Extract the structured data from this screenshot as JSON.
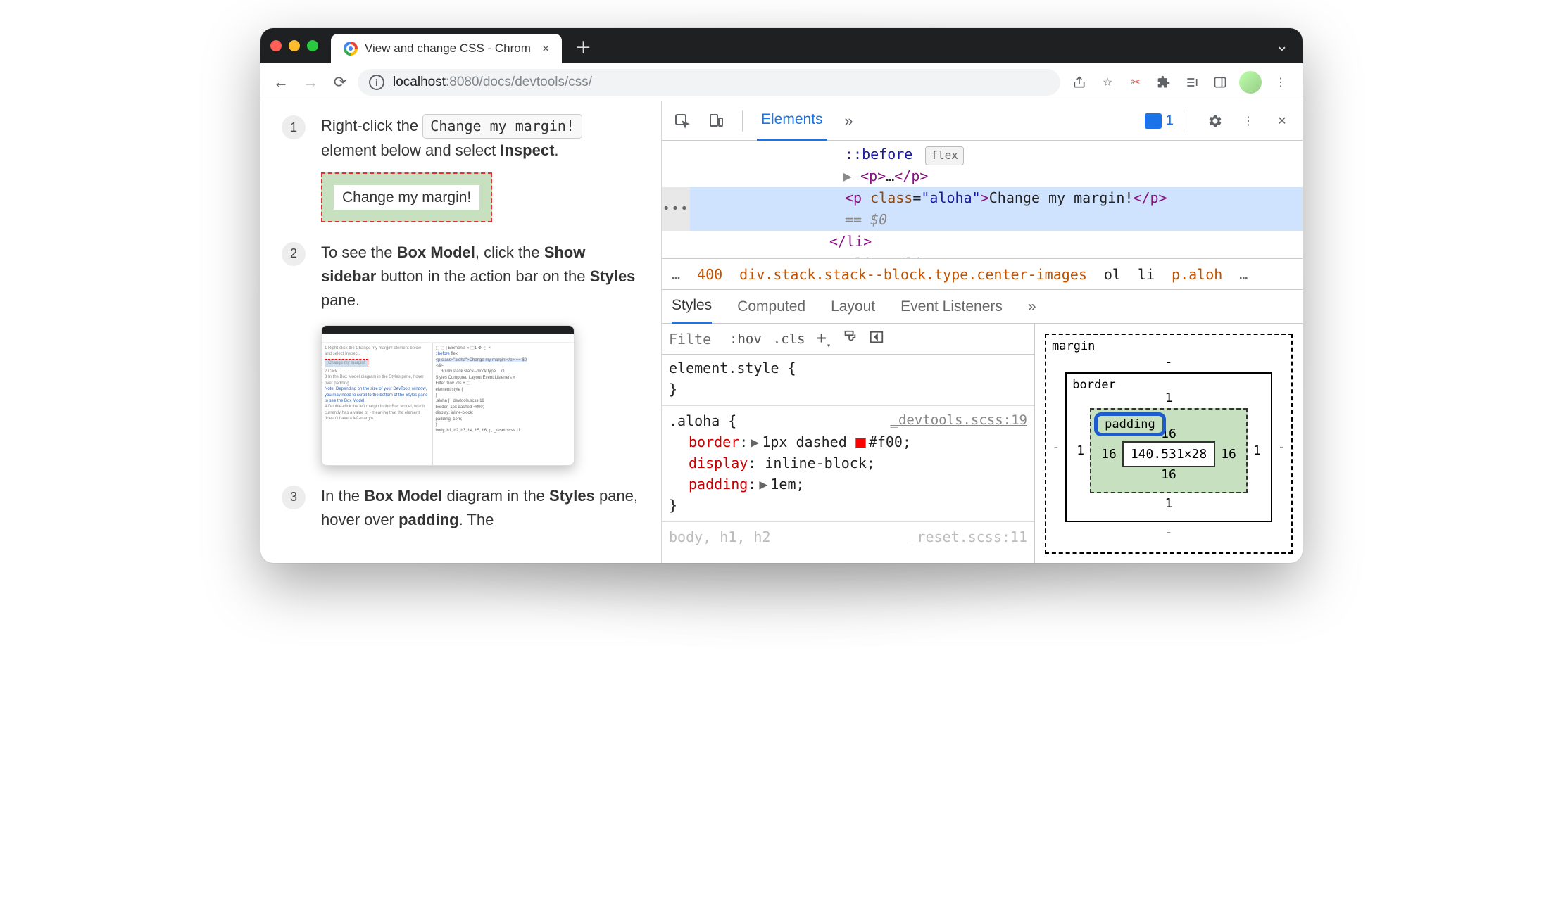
{
  "titlebar": {
    "tab_title": "View and change CSS - Chrom"
  },
  "addressbar": {
    "host": "localhost",
    "port_path": ":8080/docs/devtools/css/"
  },
  "page": {
    "step1_num": "1",
    "step1_a": "Right-click the ",
    "step1_kbd": "Change my margin!",
    "step1_b": " element below and select ",
    "step1_bold": "Inspect",
    "step1_c": ".",
    "sample_text": "Change my margin!",
    "step2_num": "2",
    "step2_a": "To see the ",
    "step2_bold1": "Box Model",
    "step2_b": ", click the ",
    "step2_bold2": "Show sidebar",
    "step2_c": " button in the action bar on the ",
    "step2_bold3": "Styles",
    "step2_d": " pane.",
    "step3_num": "3",
    "step3_a": "In the ",
    "step3_bold1": "Box Model",
    "step3_b": " diagram in the ",
    "step3_bold2": "Styles",
    "step3_c": " pane, hover over ",
    "step3_bold3": "padding",
    "step3_d": ". The"
  },
  "devtools": {
    "tab_active": "Elements",
    "issues_count": "1",
    "dom": {
      "before": "::before",
      "flex_badge": "flex",
      "p_collapsed": "<p>…</p>",
      "sel_open": "<p ",
      "sel_class_key": "class",
      "sel_class_val": "\"aloha\"",
      "sel_text": "Change my margin!",
      "sel_close": "</p>",
      "eq0": "== $0",
      "li_close": "</li>",
      "li_next": "<li>…</li>"
    },
    "crumbs": {
      "e1": "…",
      "num400": "400",
      "mid": "div.stack.stack--block.type.center-images",
      "ol": "ol",
      "li": "li",
      "cur": "p.aloh",
      "e2": "…"
    },
    "subtabs": {
      "styles": "Styles",
      "computed": "Computed",
      "layout": "Layout",
      "ev": "Event Listeners"
    },
    "filter": {
      "placeholder": "Filte",
      "hov": ":hov",
      "cls": ".cls"
    },
    "rules": {
      "es_open": "element.style {",
      "es_close": "}",
      "aloha_sel": ".aloha {",
      "aloha_src": "_devtools.scss:19",
      "p_border_k": "border",
      "p_border_v": "1px dashed ",
      "p_border_c": "#f00",
      "p_display_k": "display",
      "p_display_v": "inline-block",
      "p_padding_k": "padding",
      "p_padding_v": "1em",
      "aloha_close": "}",
      "faint_left": "body, h1, h2",
      "faint_right": "_reset.scss:11"
    },
    "box": {
      "margin": "margin",
      "margin_t": "-",
      "margin_l": "-",
      "margin_r": "-",
      "margin_b": "-",
      "border": "border",
      "border_t": "1",
      "border_l": "1",
      "border_r": "1",
      "border_b": "1",
      "padding": "padding",
      "pad_t": "16",
      "pad_l": "16",
      "pad_r": "16",
      "pad_b": "16",
      "content": "140.531×28"
    }
  }
}
